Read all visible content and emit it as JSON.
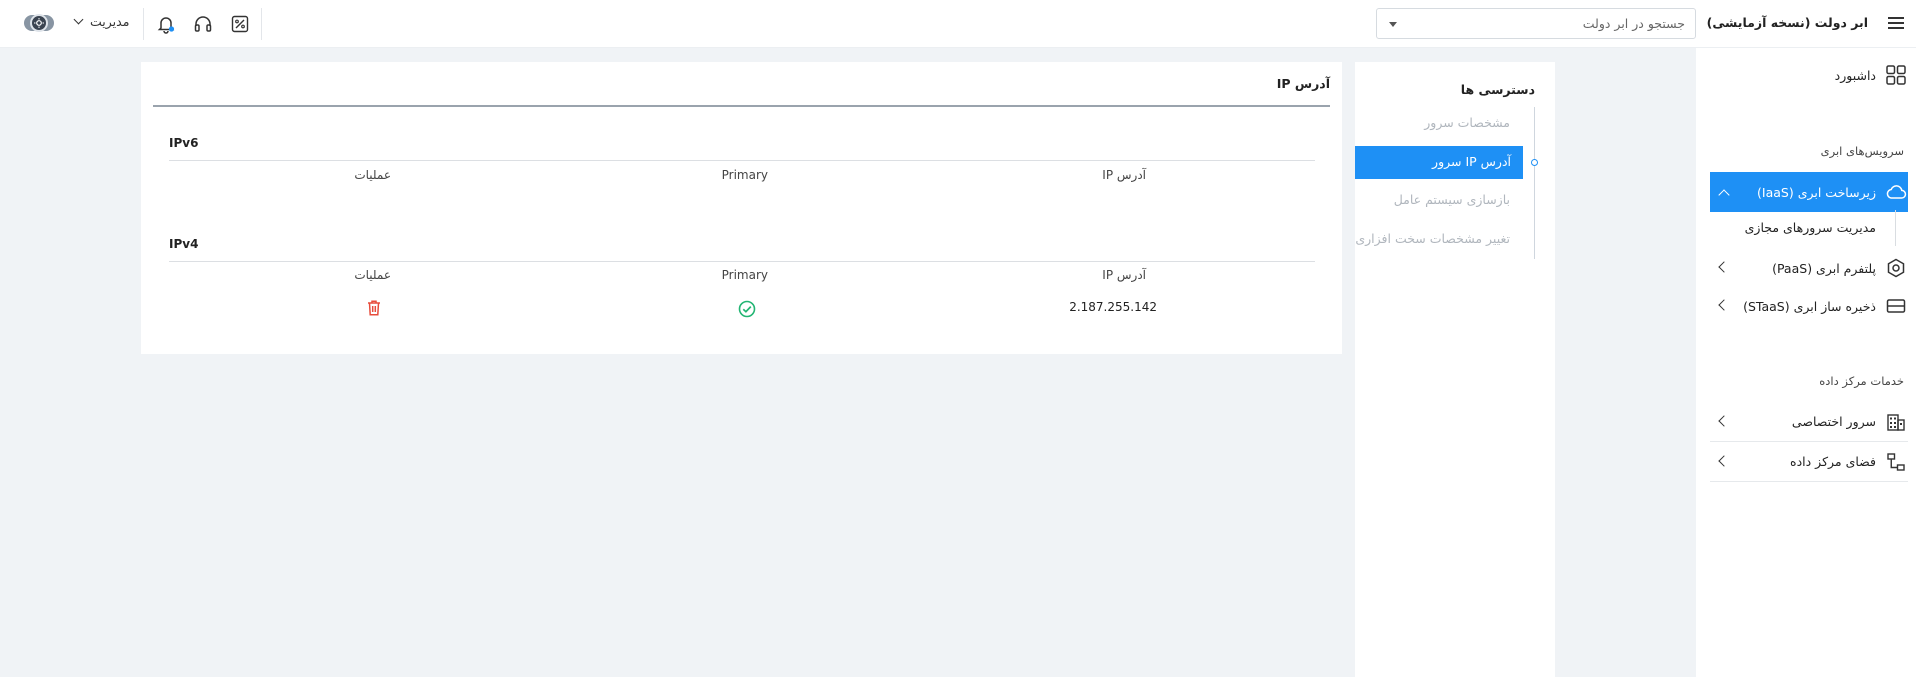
{
  "header": {
    "app_title": "ابر دولت (نسخه آزمایشی)",
    "search_placeholder": "جستجو در ابر دولت",
    "admin_label": "مدیریت",
    "icons": [
      "menu-icon",
      "tag-icon",
      "headset-icon",
      "bell-icon",
      "theme-toggle-icon"
    ]
  },
  "sidebar": {
    "dashboard": "داشبورد",
    "cloud_section": "سرویس‌های ابری",
    "iaas": "زیرساخت ابری (IaaS)",
    "iaas_sub": "مدیریت سرورهای مجازی",
    "paas": "پلتفرم ابری (PaaS)",
    "staas": "ذخیره ساز ابری (STaaS)",
    "dc_section": "خدمات مرکز داده",
    "dedicated": "سرور اختصاصی",
    "colocation": "فضای مرکز داده"
  },
  "access": {
    "title": "دسترسی ها",
    "items": [
      "مشخصات سرور",
      "آدرس IP سرور",
      "بازسازی سیستم عامل",
      "تغییر مشخصات سخت افزاری"
    ],
    "active_index": 1
  },
  "card": {
    "title": "آدرس IP",
    "ipv6": {
      "label": "IPv6",
      "headers": [
        "آدرس IP",
        "Primary",
        "عملیات"
      ],
      "rows": []
    },
    "ipv4": {
      "label": "IPv4",
      "headers": [
        "آدرس IP",
        "Primary",
        "عملیات"
      ],
      "rows": [
        {
          "ip": "2.187.255.142",
          "primary": true,
          "action": "delete-icon"
        }
      ]
    }
  },
  "colors": {
    "accent": "#1e90f5",
    "success": "#22b573",
    "danger": "#e74c3c"
  }
}
